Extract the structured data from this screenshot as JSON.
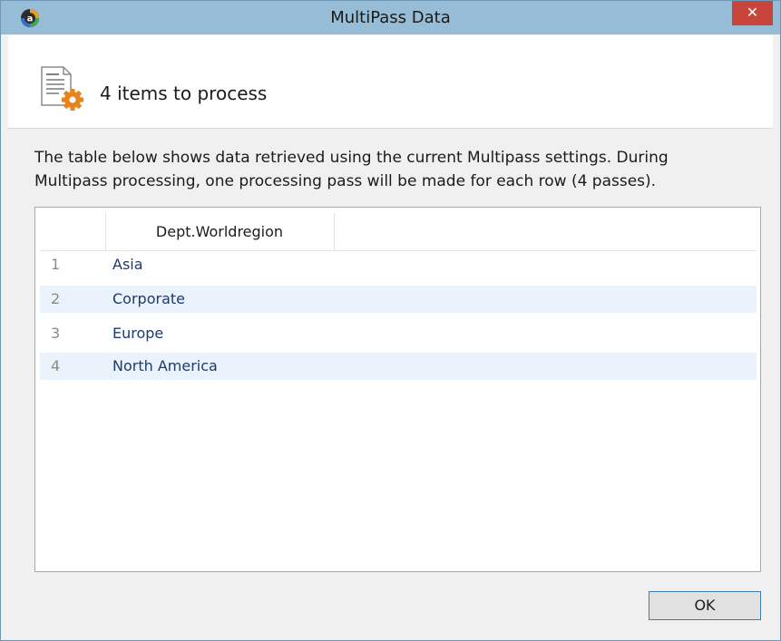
{
  "window": {
    "title": "MultiPass Data",
    "close_glyph": "✕"
  },
  "header": {
    "icon": "document-gear-icon",
    "title": "4 items to process"
  },
  "description": {
    "line1": "The table below shows data retrieved using the current Multipass settings. During",
    "line2": "Multipass processing, one processing pass will be made for each row (4 passes)."
  },
  "table": {
    "columns": [
      "Dept.Worldregion"
    ],
    "rows": [
      {
        "num": "1",
        "value": "Asia"
      },
      {
        "num": "2",
        "value": "Corporate"
      },
      {
        "num": "3",
        "value": "Europe"
      },
      {
        "num": "4",
        "value": "North America"
      }
    ]
  },
  "buttons": {
    "ok_label": "OK"
  },
  "colors": {
    "titlebar": "#97bcd6",
    "close": "#c7453b",
    "row_alt": "#eaf2fb",
    "accent_border": "#3c7fb1"
  }
}
